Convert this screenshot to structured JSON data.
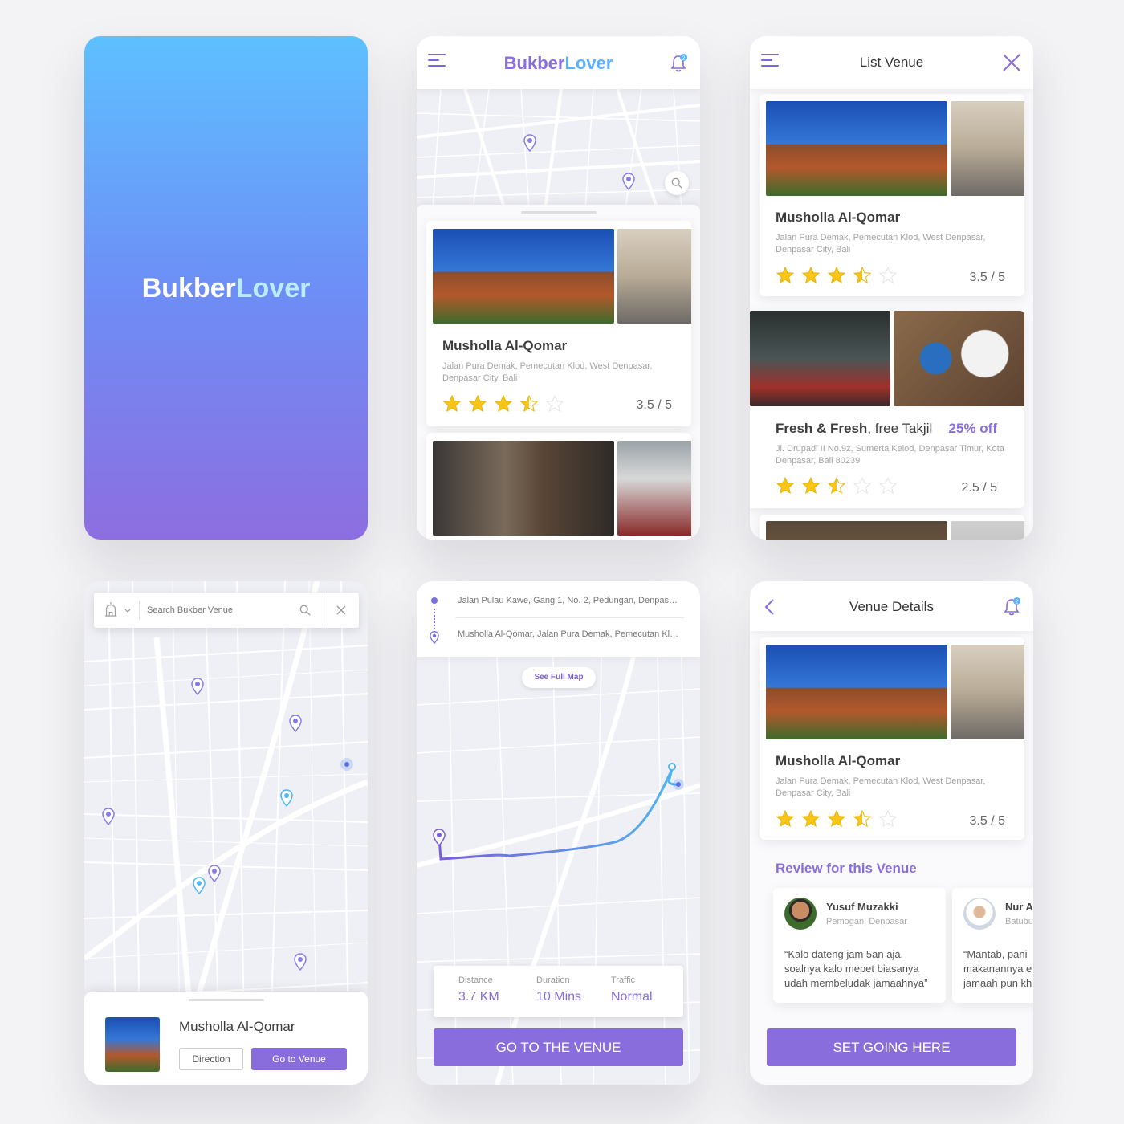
{
  "splash": {
    "brand_part1": "Bukber",
    "brand_part2": "Lover"
  },
  "home": {
    "brand_part1": "Bukber",
    "brand_part2": "Lover",
    "bell_badge": "2",
    "card": {
      "name": "Musholla Al-Qomar",
      "address": "Jalan Pura Demak, Pemecutan Klod, West Denpasar, Denpasar City, Bali",
      "rating_text": "3.5 / 5",
      "rating_value": 3.5
    }
  },
  "list_venue": {
    "title": "List Venue",
    "items": [
      {
        "name": "Musholla Al-Qomar",
        "name_extra": "",
        "promo": "",
        "address": "Jalan Pura Demak, Pemecutan Klod, West Denpasar, Denpasar City, Bali",
        "rating_text": "3.5 / 5",
        "rating_value": 3.5
      },
      {
        "name": "Fresh & Fresh",
        "name_extra": ", free Takjil",
        "promo": "25% off",
        "address": "Jl. Drupadi II No.9z, Sumerta Kelod, Denpasar Timur, Kota Denpasar, Bali 80239",
        "rating_text": "2.5 / 5",
        "rating_value": 2.5
      }
    ]
  },
  "map_search": {
    "search_placeholder": "Search Bukber Venue",
    "bottom": {
      "name": "Musholla Al-Qomar",
      "direction_label": "Direction",
      "go_label": "Go to Venue"
    }
  },
  "route": {
    "from": "Jalan Pulau Kawe, Gang 1, No. 2, Pedungan, Denpas…",
    "to": "Musholla Al-Qomar, Jalan Pura Demak, Pemecutan Kl…",
    "see_full_map": "See Full Map",
    "stats": [
      {
        "label": "Distance",
        "value": "3.7 KM"
      },
      {
        "label": "Duration",
        "value": "10 Mins"
      },
      {
        "label": "Traffic",
        "value": "Normal"
      }
    ],
    "cta": "GO TO THE VENUE"
  },
  "details": {
    "title": "Venue Details",
    "bell_badge": "2",
    "name": "Musholla Al-Qomar",
    "address": "Jalan Pura Demak, Pemecutan Klod, West Denpasar, Denpasar City, Bali",
    "rating_text": "3.5 / 5",
    "rating_value": 3.5,
    "review_heading": "Review for this Venue",
    "reviews": [
      {
        "name": "Yusuf Muzakki",
        "location": "Pemogan, Denpasar",
        "text": "“Kalo dateng jam 5an aja, soalnya kalo mepet biasanya udah membeludak jamaahnya”"
      },
      {
        "name": "Nur A",
        "location": "Batubu",
        "text": "“Mantab, pani makanannya e jamaah pun kh"
      }
    ],
    "cta": "SET GOING HERE"
  },
  "colors": {
    "accent": "#8a6ddd",
    "blue": "#5ab2ff",
    "star": "#f5c518"
  }
}
